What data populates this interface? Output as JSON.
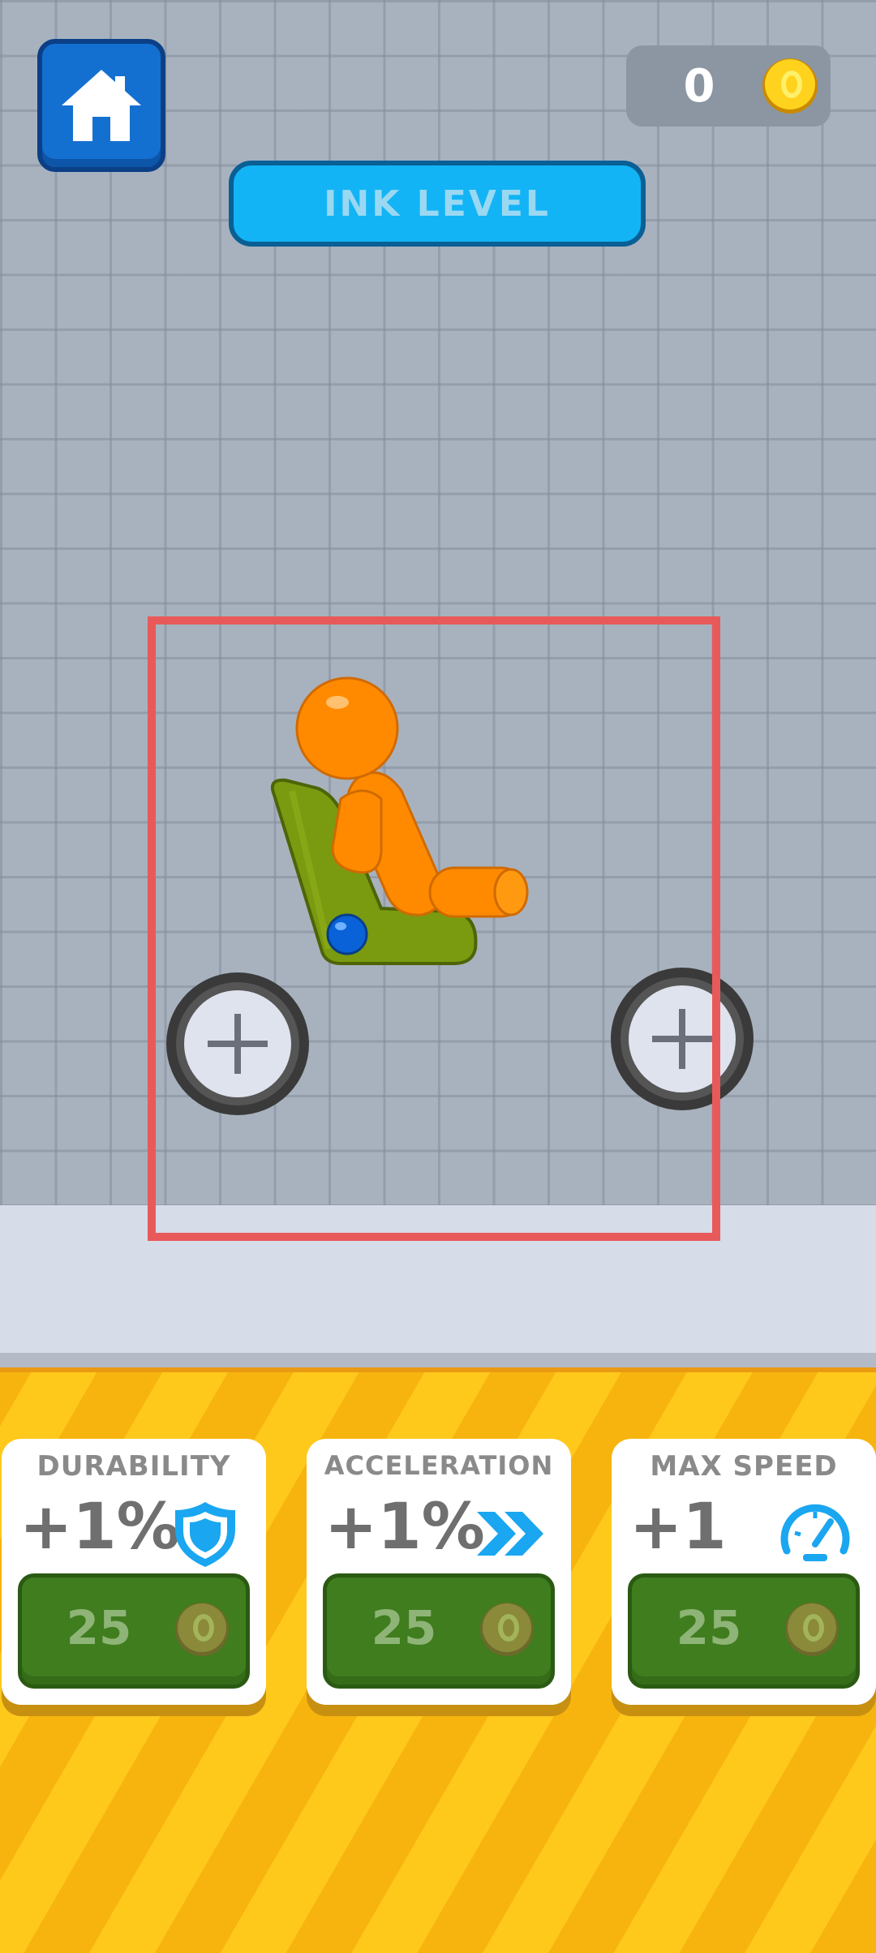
{
  "hud": {
    "coins": "0",
    "ink_level_label": "INK LEVEL"
  },
  "icons": {
    "home": "home-icon",
    "coin": "coin-icon",
    "shield": "shield-icon",
    "double_chevron": "double-chevron-icon",
    "speedometer": "speedometer-icon",
    "wheel_add": "plus-icon"
  },
  "colors": {
    "home_button": "#1470d0",
    "ink_bar": "#13b4f5",
    "build_frame": "#e85a5a",
    "buy_button": "#3f7d1e",
    "accent_icon": "#1aa6f0",
    "character": "#ff8a00",
    "seat": "#7a9a10"
  },
  "upgrades": [
    {
      "title": "DURABILITY",
      "value": "+1%",
      "price": "25",
      "icon": "shield-icon"
    },
    {
      "title": "ACCELERATION",
      "value": "+1%",
      "price": "25",
      "icon": "double-chevron-icon"
    },
    {
      "title": "MAX SPEED",
      "value": "+1",
      "price": "25",
      "icon": "speedometer-icon"
    }
  ]
}
